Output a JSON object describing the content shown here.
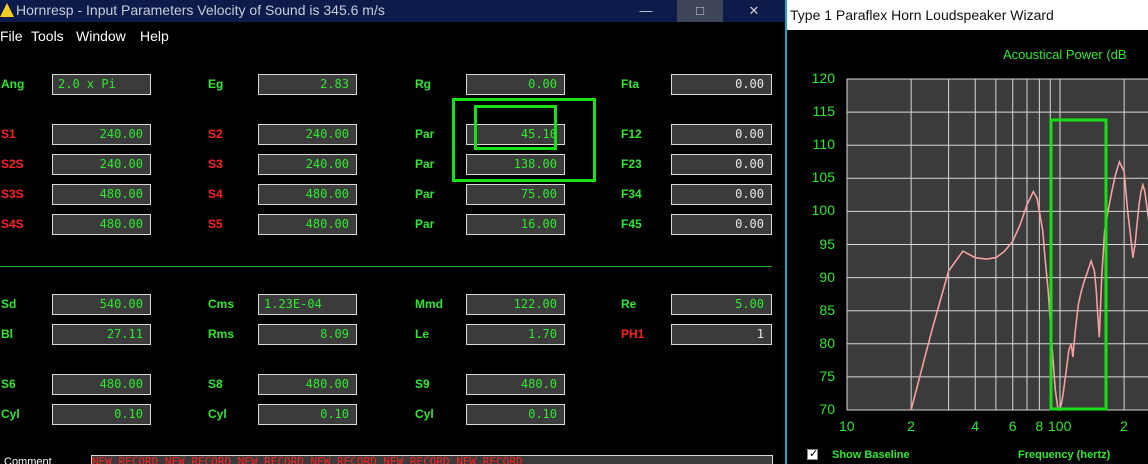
{
  "left_window": {
    "title": "Hornresp - Input Parameters   Velocity of Sound is 345.6 m/s",
    "buttons": {
      "minimize": "—",
      "maximize": "□",
      "close": "✕"
    },
    "menu": [
      "File",
      "Tools",
      "Window",
      "Help"
    ],
    "rows": [
      {
        "l1": "Ang",
        "v1": "2.0 x Pi",
        "l2": "Eg",
        "v2": "2.83",
        "l3": "Rg",
        "v3": "0.00",
        "l4": "Fta",
        "v4": "0.00"
      },
      {
        "l1": "S1",
        "v1": "240.00",
        "l2": "S2",
        "v2": "240.00",
        "l3": "Par",
        "v3": "45.10",
        "l4": "F12",
        "v4": "0.00"
      },
      {
        "l1": "S2S",
        "v1": "240.00",
        "l2": "S3",
        "v2": "240.00",
        "l3": "Par",
        "v3": "138.00",
        "l4": "F23",
        "v4": "0.00"
      },
      {
        "l1": "S3S",
        "v1": "480.00",
        "l2": "S4",
        "v2": "480.00",
        "l3": "Par",
        "v3": "75.00",
        "l4": "F34",
        "v4": "0.00"
      },
      {
        "l1": "S4S",
        "v1": "480.00",
        "l2": "S5",
        "v2": "480.00",
        "l3": "Par",
        "v3": "16.00",
        "l4": "F45",
        "v4": "0.00"
      }
    ],
    "rows2": [
      {
        "l1": "Sd",
        "v1": "540.00",
        "l2": "Cms",
        "v2": "1.23E-04",
        "l3": "Mmd",
        "v3": "122.00",
        "l4": "Re",
        "v4": "5.00"
      },
      {
        "l1": "Bl",
        "v1": "27.11",
        "l2": "Rms",
        "v2": "8.09",
        "l3": "Le",
        "v3": "1.70",
        "l4": "PH1",
        "v4": "1"
      }
    ],
    "rows3": [
      {
        "l1": "S6",
        "v1": "480.00",
        "l2": "S8",
        "v2": "480.00",
        "l3": "S9",
        "v3": "480.0"
      },
      {
        "l1": "Cyl",
        "v1": "0.10",
        "l2": "Cyl",
        "v2": "0.10",
        "l3": "Cyl",
        "v3": "0.10"
      }
    ],
    "comment_label": "Comment",
    "comment_value": "NEW RECORD  NEW RECORD  NEW RECORD  NEW RECORD  NEW RECORD  NEW RECORD",
    "colors": {
      "label_green": "#2ee82e",
      "label_red": "#ff2020",
      "highlight": "#17e017"
    }
  },
  "right_window": {
    "title": "Type 1 Paraflex Horn Loudspeaker Wizard",
    "show_baseline_label": "Show Baseline",
    "show_baseline_checked": true,
    "frequency_label": "Frequency (hertz)"
  },
  "chart_data": {
    "type": "line",
    "title": "Acoustical Power (dB",
    "x_scale": "log",
    "xlabel": "Frequency (hertz)",
    "ylabel": "",
    "ylim": [
      70,
      120
    ],
    "yticks": [
      "120",
      "115",
      "110",
      "105",
      "100",
      "95",
      "90",
      "85",
      "80",
      "75",
      "70"
    ],
    "xtick_labels": [
      "10",
      "2",
      "4",
      "6",
      "8",
      "100",
      "2"
    ],
    "xlim": [
      10,
      290
    ],
    "grid": true,
    "series": [
      {
        "color": "#f4a0a0",
        "x": [
          20,
          25,
          30,
          35,
          40,
          45,
          50,
          55,
          60,
          65,
          70,
          75,
          78,
          81,
          83,
          85,
          88,
          92,
          95,
          98,
          100,
          103,
          107,
          110,
          113,
          115,
          118,
          122,
          126,
          130,
          135,
          140,
          145,
          148,
          150,
          153,
          157,
          162,
          168,
          175,
          182,
          190,
          200,
          208,
          215,
          220,
          225,
          230,
          235,
          240,
          245,
          250,
          255,
          260,
          265,
          270,
          280,
          290
        ],
        "y": [
          70,
          82,
          91,
          94,
          93,
          92.8,
          93,
          94,
          95.5,
          98,
          101,
          103,
          102,
          99,
          97,
          93,
          88,
          79,
          73,
          70,
          70,
          72,
          76,
          79,
          80,
          78,
          82,
          86,
          88,
          89.5,
          91,
          92.5,
          91,
          88,
          85,
          81,
          90,
          97,
          100,
          103,
          105.5,
          107.5,
          106,
          100,
          96,
          93,
          95,
          98,
          101,
          103,
          104,
          103,
          101,
          99,
          97,
          96,
          95,
          94
        ]
      }
    ]
  }
}
